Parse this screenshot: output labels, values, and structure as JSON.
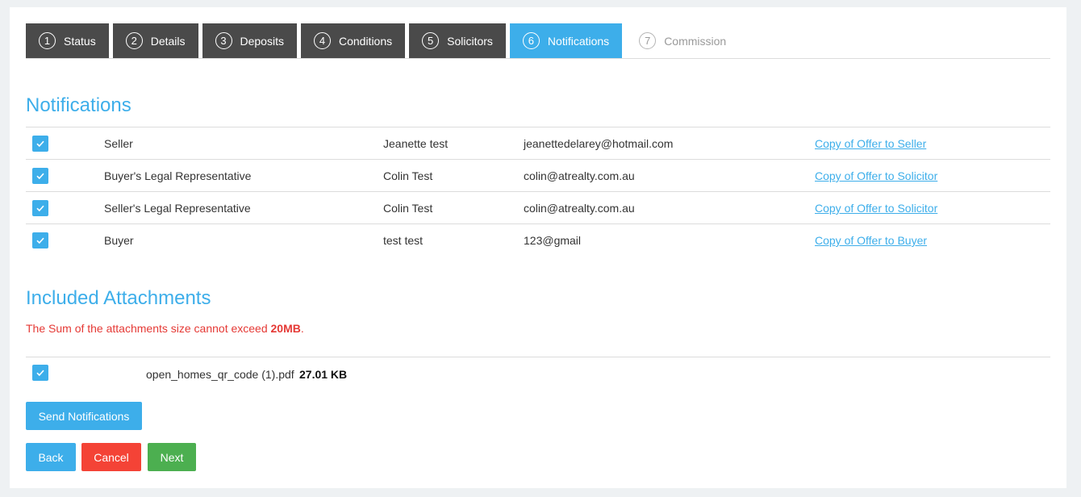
{
  "steps": [
    {
      "num": "1",
      "label": "Status"
    },
    {
      "num": "2",
      "label": "Details"
    },
    {
      "num": "3",
      "label": "Deposits"
    },
    {
      "num": "4",
      "label": "Conditions"
    },
    {
      "num": "5",
      "label": "Solicitors"
    },
    {
      "num": "6",
      "label": "Notifications"
    },
    {
      "num": "7",
      "label": "Commission"
    }
  ],
  "notifications": {
    "title": "Notifications",
    "rows": [
      {
        "checked": true,
        "role": "Seller",
        "name": "Jeanette test",
        "email": "jeanettedelarey@hotmail.com",
        "link": "Copy of Offer to Seller"
      },
      {
        "checked": true,
        "role": "Buyer's Legal Representative",
        "name": "Colin Test",
        "email": "colin@atrealty.com.au",
        "link": "Copy of Offer to Solicitor"
      },
      {
        "checked": true,
        "role": "Seller's Legal Representative",
        "name": "Colin Test",
        "email": "colin@atrealty.com.au",
        "link": "Copy of Offer to Solicitor"
      },
      {
        "checked": true,
        "role": "Buyer",
        "name": "test test",
        "email": "123@gmail",
        "link": "Copy of Offer to Buyer"
      }
    ]
  },
  "attachments": {
    "title": "Included Attachments",
    "warning_prefix": "The Sum of the attachments size cannot exceed ",
    "warning_limit": "20MB",
    "warning_suffix": ".",
    "files": [
      {
        "checked": true,
        "name": "open_homes_qr_code (1).pdf",
        "size": "27.01 KB"
      }
    ]
  },
  "buttons": {
    "send": "Send Notifications",
    "back": "Back",
    "cancel": "Cancel",
    "next": "Next"
  },
  "colors": {
    "accent": "#3daeea",
    "step_dark": "#4a4a4a",
    "danger": "#f44336",
    "success": "#4caf50",
    "warning_text": "#e53935"
  },
  "icons": {
    "checkbox": "check-icon"
  }
}
